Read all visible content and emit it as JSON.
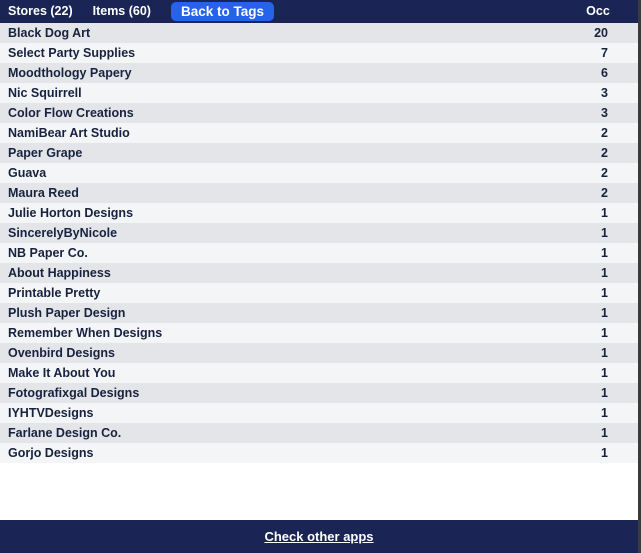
{
  "header": {
    "stores_tab": "Stores (22)",
    "items_tab": "Items (60)",
    "back_button": "Back to Tags",
    "occ_column": "Occ",
    "background_color": "#1b2555",
    "button_color": "#2563eb"
  },
  "table": {
    "row_alt_color": "#e3e5e8",
    "row_color": "#f4f5f7",
    "rows": [
      {
        "name": "Black Dog Art",
        "occ": "20"
      },
      {
        "name": "Select Party Supplies",
        "occ": "7"
      },
      {
        "name": "Moodthology Papery",
        "occ": "6"
      },
      {
        "name": "Nic Squirrell",
        "occ": "3"
      },
      {
        "name": "Color Flow Creations",
        "occ": "3"
      },
      {
        "name": "NamiBear Art Studio",
        "occ": "2"
      },
      {
        "name": "Paper Grape",
        "occ": "2"
      },
      {
        "name": "Guava",
        "occ": "2"
      },
      {
        "name": "Maura Reed",
        "occ": "2"
      },
      {
        "name": "Julie Horton Designs",
        "occ": "1"
      },
      {
        "name": "SincerelyByNicole",
        "occ": "1"
      },
      {
        "name": "NB Paper Co.",
        "occ": "1"
      },
      {
        "name": "About Happiness",
        "occ": "1"
      },
      {
        "name": "Printable Pretty",
        "occ": "1"
      },
      {
        "name": "Plush Paper Design",
        "occ": "1"
      },
      {
        "name": "Remember When Designs",
        "occ": "1"
      },
      {
        "name": "Ovenbird Designs",
        "occ": "1"
      },
      {
        "name": "Make It About You",
        "occ": "1"
      },
      {
        "name": "Fotografixgal Designs",
        "occ": "1"
      },
      {
        "name": "IYHTVDesigns",
        "occ": "1"
      },
      {
        "name": "Farlane Design Co.",
        "occ": "1"
      },
      {
        "name": "Gorjo Designs",
        "occ": "1"
      }
    ]
  },
  "footer": {
    "link_label": "Check other apps",
    "background_color": "#1b2555"
  }
}
